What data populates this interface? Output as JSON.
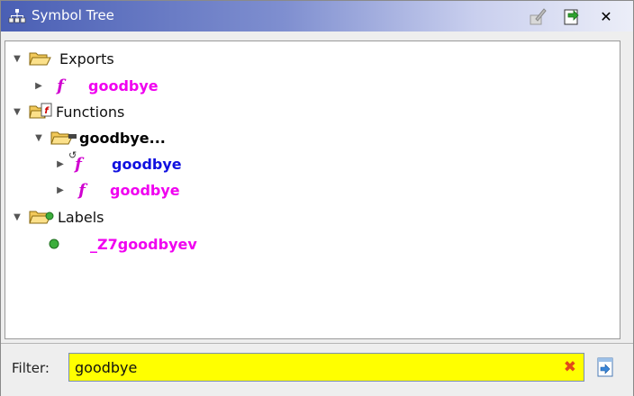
{
  "window": {
    "title": "Symbol Tree",
    "title_icon": "symbol-tree-icon",
    "toolbar": [
      {
        "name": "edit-icon",
        "glyph": "✎"
      },
      {
        "name": "navigate-icon",
        "glyph": "⇣"
      },
      {
        "name": "close-icon",
        "glyph": "✕"
      }
    ]
  },
  "tree": {
    "exports": {
      "label": "Exports",
      "children": [
        {
          "label": "goodbye"
        }
      ]
    },
    "functions": {
      "label": "Functions",
      "namespace": {
        "label": "goodbye...",
        "children": [
          {
            "label": "goodbye"
          },
          {
            "label": "goodbye"
          }
        ]
      }
    },
    "labels": {
      "label": "Labels",
      "children": [
        {
          "label": "_Z7goodbyev"
        }
      ]
    }
  },
  "filter": {
    "label": "Filter:",
    "value": "goodbye"
  },
  "colors": {
    "function_text": "#f000f0",
    "thunk_text": "#1010e0",
    "filter_bg": "#ffff00"
  }
}
